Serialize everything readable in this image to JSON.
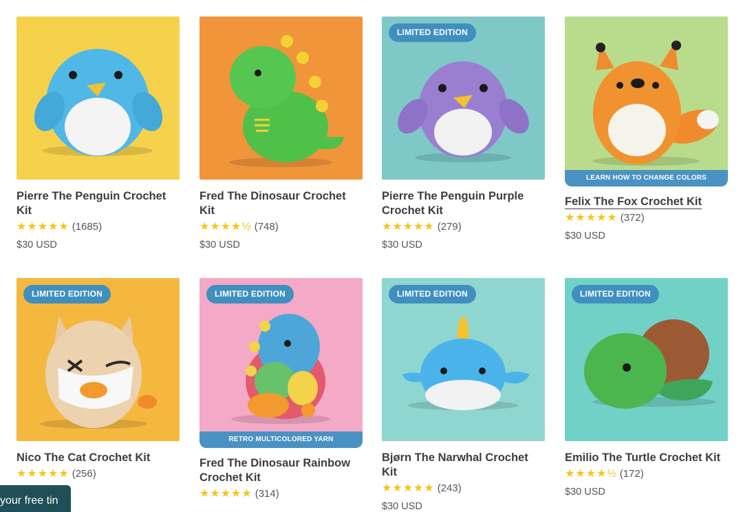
{
  "products": [
    {
      "title": "Pierre The Penguin Crochet Kit",
      "stars": "★★★★★",
      "reviews": "(1685)",
      "price": "$30 USD",
      "badge": "",
      "banner": "",
      "bg": "#f6d24c",
      "icon": "penguin-blue-image"
    },
    {
      "title": "Fred The Dinosaur Crochet Kit",
      "stars": "★★★★½",
      "reviews": "(748)",
      "price": "$30 USD",
      "badge": "",
      "banner": "",
      "bg": "#f1953a",
      "icon": "dinosaur-green-image"
    },
    {
      "title": "Pierre The Penguin Purple Crochet Kit",
      "stars": "★★★★★",
      "reviews": "(279)",
      "price": "$30 USD",
      "badge": "LIMITED EDITION",
      "banner": "",
      "bg": "#7ec9c8",
      "icon": "penguin-purple-image"
    },
    {
      "title": "Felix The Fox Crochet Kit",
      "stars": "★★★★★",
      "reviews": "(372)",
      "price": "$30 USD",
      "badge": "",
      "banner": "LEARN HOW TO CHANGE COLORS",
      "bg": "#b9dc8c",
      "icon": "fox-image"
    },
    {
      "title": "Nico The Cat Crochet Kit",
      "stars": "★★★★★",
      "reviews": "(256)",
      "price": "",
      "badge": "LIMITED EDITION",
      "banner": "",
      "bg": "#f5b83f",
      "icon": "cat-image"
    },
    {
      "title": "Fred The Dinosaur Rainbow Crochet Kit",
      "stars": "★★★★★",
      "reviews": "(314)",
      "price": "",
      "badge": "LIMITED EDITION",
      "banner": "RETRO MULTICOLORED YARN",
      "bg": "#f4a9c6",
      "icon": "dinosaur-rainbow-image"
    },
    {
      "title": "Bjørn The Narwhal Crochet Kit",
      "stars": "★★★★★",
      "reviews": "(243)",
      "price": "$30 USD",
      "badge": "LIMITED EDITION",
      "banner": "",
      "bg": "#8fd6d0",
      "icon": "narwhal-image"
    },
    {
      "title": "Emilio The Turtle Crochet Kit",
      "stars": "★★★★½",
      "reviews": "(172)",
      "price": "$30 USD",
      "badge": "LIMITED EDITION",
      "banner": "",
      "bg": "#72d1c6",
      "icon": "turtle-image"
    }
  ],
  "promo": {
    "label": "your free tin"
  }
}
